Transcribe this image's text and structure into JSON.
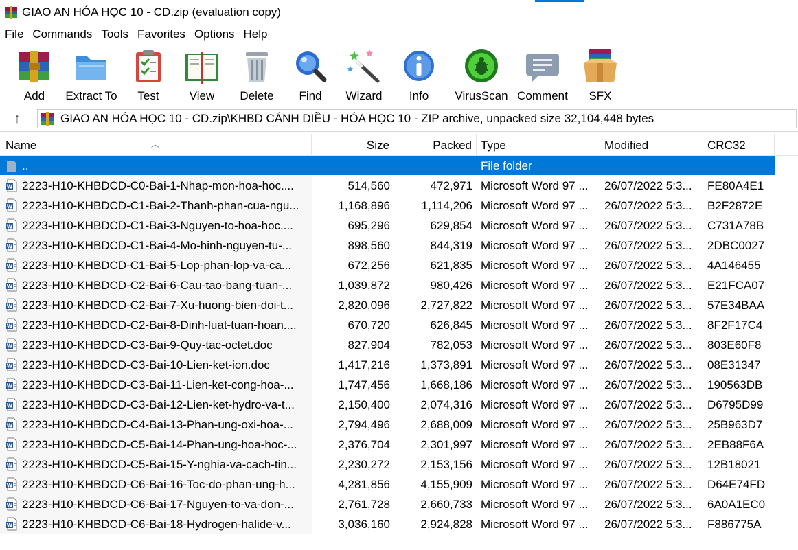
{
  "window": {
    "title": "GIAO AN HÓA HỌC 10 - CD.zip (evaluation copy)"
  },
  "menu": [
    "File",
    "Commands",
    "Tools",
    "Favorites",
    "Options",
    "Help"
  ],
  "toolbar": {
    "add": "Add",
    "extract_to": "Extract To",
    "test": "Test",
    "view": "View",
    "delete": "Delete",
    "find": "Find",
    "wizard": "Wizard",
    "info": "Info",
    "virusscan": "VirusScan",
    "comment": "Comment",
    "sfx": "SFX"
  },
  "address": {
    "up_arrow": "↑",
    "path": "GIAO AN HÓA HỌC 10 - CD.zip\\KHBD CÁNH DIỀU - HÓA HỌC 10 - ZIP archive, unpacked size 32,104,448 bytes"
  },
  "columns": {
    "name": "Name",
    "size": "Size",
    "packed": "Packed",
    "type": "Type",
    "modified": "Modified",
    "crc": "CRC32"
  },
  "parent_row": {
    "name": "..",
    "type": "File folder"
  },
  "files": [
    {
      "name": "2223-H10-KHBDCD-C0-Bai-1-Nhap-mon-hoa-hoc....",
      "size": "514,560",
      "packed": "472,971",
      "type": "Microsoft Word 97 ...",
      "modified": "26/07/2022 5:3...",
      "crc": "FE80A4E1"
    },
    {
      "name": "2223-H10-KHBDCD-C1-Bai-2-Thanh-phan-cua-ngu...",
      "size": "1,168,896",
      "packed": "1,114,206",
      "type": "Microsoft Word 97 ...",
      "modified": "26/07/2022 5:3...",
      "crc": "B2F2872E"
    },
    {
      "name": "2223-H10-KHBDCD-C1-Bai-3-Nguyen-to-hoa-hoc....",
      "size": "695,296",
      "packed": "629,854",
      "type": "Microsoft Word 97 ...",
      "modified": "26/07/2022 5:3...",
      "crc": "C731A78B"
    },
    {
      "name": "2223-H10-KHBDCD-C1-Bai-4-Mo-hinh-nguyen-tu-...",
      "size": "898,560",
      "packed": "844,319",
      "type": "Microsoft Word 97 ...",
      "modified": "26/07/2022 5:3...",
      "crc": "2DBC0027"
    },
    {
      "name": "2223-H10-KHBDCD-C1-Bai-5-Lop-phan-lop-va-ca...",
      "size": "672,256",
      "packed": "621,835",
      "type": "Microsoft Word 97 ...",
      "modified": "26/07/2022 5:3...",
      "crc": "4A146455"
    },
    {
      "name": "2223-H10-KHBDCD-C2-Bai-6-Cau-tao-bang-tuan-...",
      "size": "1,039,872",
      "packed": "980,426",
      "type": "Microsoft Word 97 ...",
      "modified": "26/07/2022 5:3...",
      "crc": "E21FCA07"
    },
    {
      "name": "2223-H10-KHBDCD-C2-Bai-7-Xu-huong-bien-doi-t...",
      "size": "2,820,096",
      "packed": "2,727,822",
      "type": "Microsoft Word 97 ...",
      "modified": "26/07/2022 5:3...",
      "crc": "57E34BAA"
    },
    {
      "name": "2223-H10-KHBDCD-C2-Bai-8-Dinh-luat-tuan-hoan....",
      "size": "670,720",
      "packed": "626,845",
      "type": "Microsoft Word 97 ...",
      "modified": "26/07/2022 5:3...",
      "crc": "8F2F17C4"
    },
    {
      "name": "2223-H10-KHBDCD-C3-Bai-9-Quy-tac-octet.doc",
      "size": "827,904",
      "packed": "782,053",
      "type": "Microsoft Word 97 ...",
      "modified": "26/07/2022 5:3...",
      "crc": "803E60F8"
    },
    {
      "name": "2223-H10-KHBDCD-C3-Bai-10-Lien-ket-ion.doc",
      "size": "1,417,216",
      "packed": "1,373,891",
      "type": "Microsoft Word 97 ...",
      "modified": "26/07/2022 5:3...",
      "crc": "08E31347"
    },
    {
      "name": "2223-H10-KHBDCD-C3-Bai-11-Lien-ket-cong-hoa-...",
      "size": "1,747,456",
      "packed": "1,668,186",
      "type": "Microsoft Word 97 ...",
      "modified": "26/07/2022 5:3...",
      "crc": "190563DB"
    },
    {
      "name": "2223-H10-KHBDCD-C3-Bai-12-Lien-ket-hydro-va-t...",
      "size": "2,150,400",
      "packed": "2,074,316",
      "type": "Microsoft Word 97 ...",
      "modified": "26/07/2022 5:3...",
      "crc": "D6795D99"
    },
    {
      "name": "2223-H10-KHBDCD-C4-Bai-13-Phan-ung-oxi-hoa-...",
      "size": "2,794,496",
      "packed": "2,688,009",
      "type": "Microsoft Word 97 ...",
      "modified": "26/07/2022 5:3...",
      "crc": "25B963D7"
    },
    {
      "name": "2223-H10-KHBDCD-C5-Bai-14-Phan-ung-hoa-hoc-...",
      "size": "2,376,704",
      "packed": "2,301,997",
      "type": "Microsoft Word 97 ...",
      "modified": "26/07/2022 5:3...",
      "crc": "2EB88F6A"
    },
    {
      "name": "2223-H10-KHBDCD-C5-Bai-15-Y-nghia-va-cach-tin...",
      "size": "2,230,272",
      "packed": "2,153,156",
      "type": "Microsoft Word 97 ...",
      "modified": "26/07/2022 5:3...",
      "crc": "12B18021"
    },
    {
      "name": "2223-H10-KHBDCD-C6-Bai-16-Toc-do-phan-ung-h...",
      "size": "4,281,856",
      "packed": "4,155,909",
      "type": "Microsoft Word 97 ...",
      "modified": "26/07/2022 5:3...",
      "crc": "D64E74FD"
    },
    {
      "name": "2223-H10-KHBDCD-C6-Bai-17-Nguyen-to-va-don-...",
      "size": "2,761,728",
      "packed": "2,660,733",
      "type": "Microsoft Word 97 ...",
      "modified": "26/07/2022 5:3...",
      "crc": "6A0A1EC0"
    },
    {
      "name": "2223-H10-KHBDCD-C6-Bai-18-Hydrogen-halide-v...",
      "size": "3,036,160",
      "packed": "2,924,828",
      "type": "Microsoft Word 97 ...",
      "modified": "26/07/2022 5:3...",
      "crc": "F886775A"
    }
  ],
  "colors": {
    "selection": "#0078d7",
    "accent": "#0078d7"
  }
}
